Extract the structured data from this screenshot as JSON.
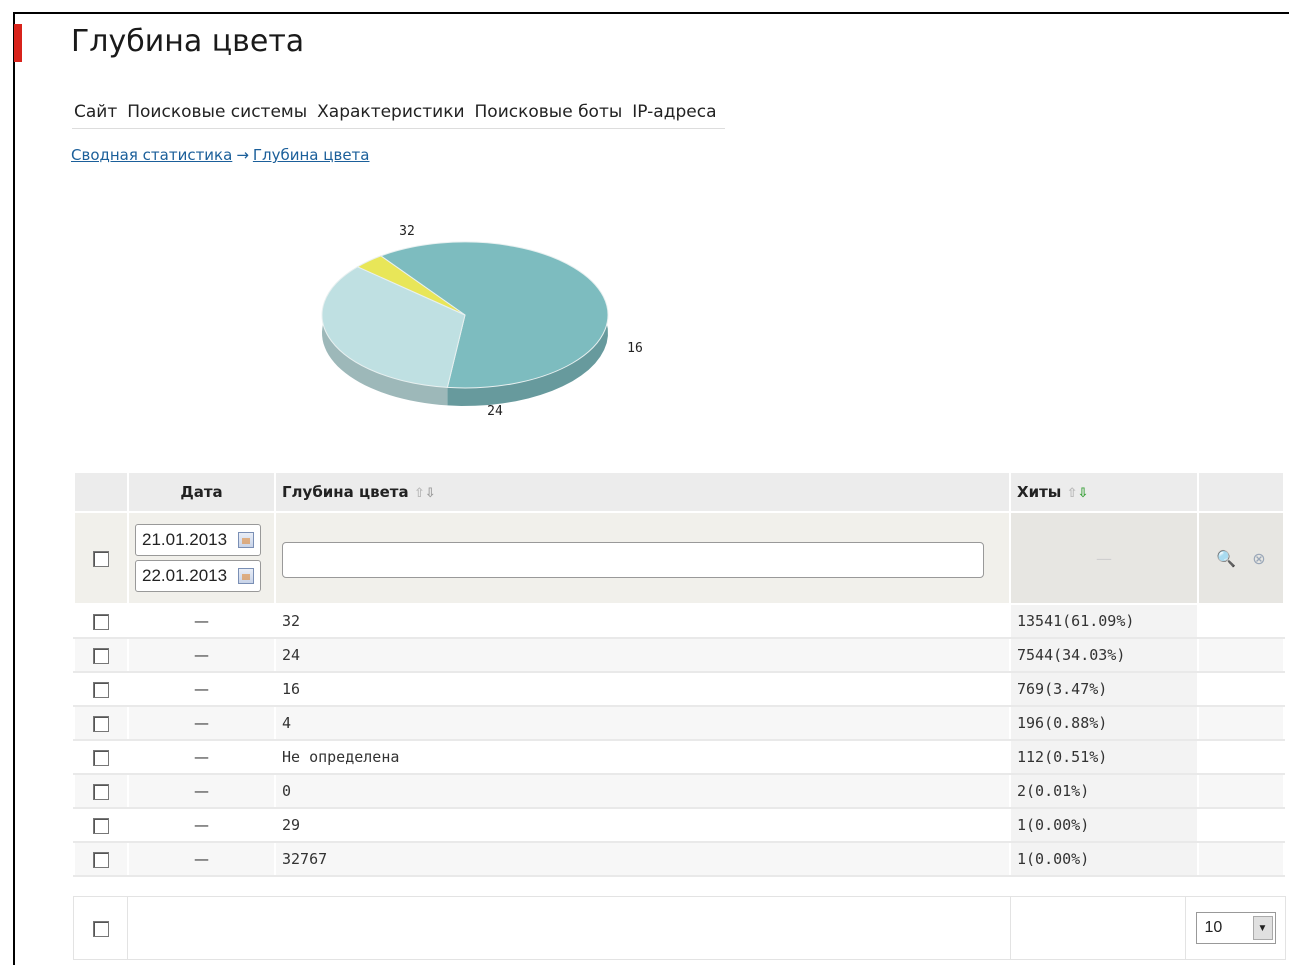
{
  "page": {
    "title": "Глубина цвета"
  },
  "tabs": [
    "Сайт",
    "Поисковые системы",
    "Характеристики",
    "Поисковые боты",
    "IP-адреса"
  ],
  "breadcrumb": {
    "parent": "Сводная статистика",
    "arrow": "→",
    "current": "Глубина цвета"
  },
  "chart_data": {
    "type": "pie",
    "categories": [
      "32",
      "24",
      "16"
    ],
    "values": [
      61.09,
      34.03,
      3.47
    ],
    "labels": [
      "32",
      "24",
      "16"
    ],
    "colors": [
      "#7dbcbf",
      "#bfe0e2",
      "#e8e658"
    ]
  },
  "table": {
    "headers": {
      "date": "Дата",
      "depth": "Глубина цвета",
      "hits": "Хиты"
    },
    "filter": {
      "date_from": "21.01.2013",
      "date_to": "22.01.2013",
      "depth_value": "",
      "hits_placeholder": "—"
    },
    "rows": [
      {
        "date": "—",
        "depth": "32",
        "hits": "13541(61.09%)"
      },
      {
        "date": "—",
        "depth": "24",
        "hits": "7544(34.03%)"
      },
      {
        "date": "—",
        "depth": "16",
        "hits": "769(3.47%)"
      },
      {
        "date": "—",
        "depth": "4",
        "hits": "196(0.88%)"
      },
      {
        "date": "—",
        "depth": "Не определена",
        "hits": "112(0.51%)"
      },
      {
        "date": "—",
        "depth": "0",
        "hits": "2(0.01%)"
      },
      {
        "date": "—",
        "depth": "29",
        "hits": "1(0.00%)"
      },
      {
        "date": "—",
        "depth": "32767",
        "hits": "1(0.00%)"
      }
    ]
  },
  "footer": {
    "per_page": "10"
  },
  "icons": {
    "sort_up": "arrow-up-icon",
    "sort_down": "arrow-down-icon",
    "search": "magnifier-icon",
    "clear": "clear-icon",
    "calendar": "calendar-icon"
  }
}
